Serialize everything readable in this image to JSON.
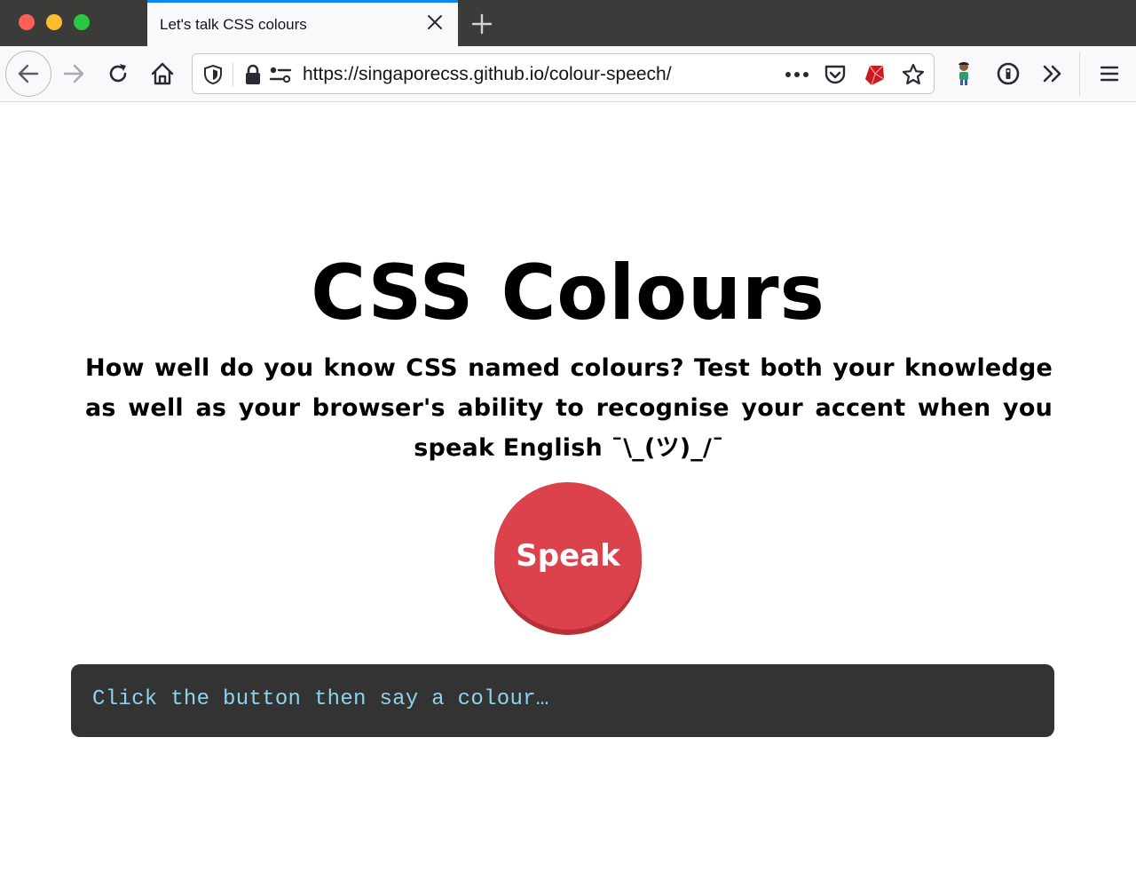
{
  "browser": {
    "tab": {
      "title": "Let's talk CSS colours"
    },
    "url": "https://singaporecss.github.io/colour-speech/",
    "icons": {
      "traffic_lights": [
        "close-window-icon",
        "minimize-window-icon",
        "zoom-window-icon"
      ],
      "tab_close": "close-icon",
      "new_tab": "plus-icon",
      "back": "arrow-left-icon",
      "forward": "arrow-right-icon",
      "reload": "reload-icon",
      "home": "home-icon",
      "tracking": "shield-icon",
      "secure": "lock-icon",
      "permissions": "permissions-icon",
      "page_actions": "more-horizontal-icon",
      "pocket": "pocket-icon",
      "extension_ruby": "ruby-gem-icon",
      "bookmark": "star-icon",
      "profile": "avatar-icon",
      "password_manager": "info-circle-icon",
      "overflow": "chevron-double-right-icon",
      "menu": "hamburger-menu-icon"
    },
    "colors": {
      "tabstrip": "#3b3b39",
      "active_tab_accent": "#0a84ff",
      "toolbar": "#f9f9fb"
    }
  },
  "page": {
    "title": "CSS Colours",
    "intro": "How well do you know CSS named colours? Test both your knowledge as well as your browser's ability to recognise your accent when you speak English ¯\\_(ツ)_/¯",
    "speak_label": "Speak",
    "output_text": "Click the button then say a colour…",
    "colors": {
      "speak_button": "#dc424b",
      "output_background": "#333333",
      "output_text": "#8fd2ec"
    }
  }
}
